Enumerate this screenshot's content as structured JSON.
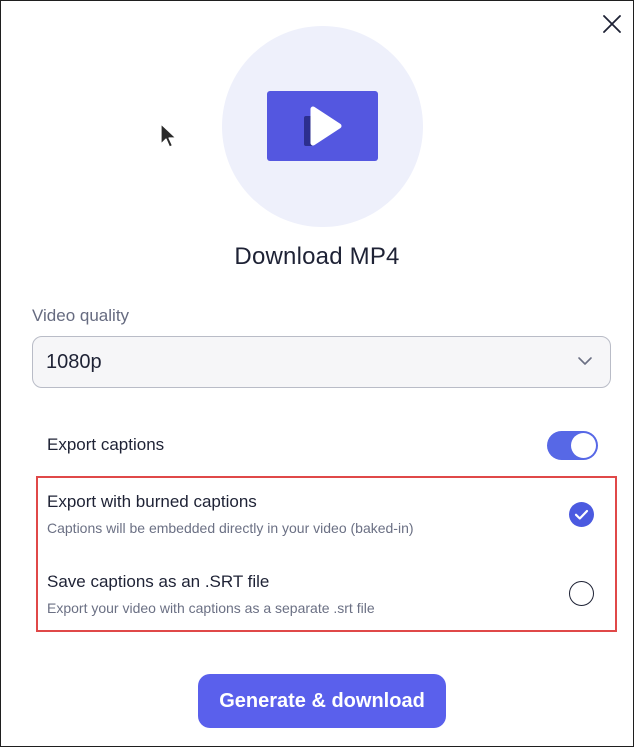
{
  "dialog": {
    "title": "Download MP4",
    "quality": {
      "label": "Video quality",
      "selected": "1080p"
    },
    "export_captions": {
      "label": "Export captions",
      "enabled": true
    },
    "options": [
      {
        "title": "Export with burned captions",
        "description": "Captions will be embedded directly in your video (baked-in)",
        "selected": true
      },
      {
        "title": "Save captions as an .SRT file",
        "description": "Export your video with captions as a separate .srt file",
        "selected": false
      }
    ],
    "primary_button": "Generate & download"
  },
  "icons": {
    "close": "close-icon",
    "hero": "video-play-icon",
    "chevron": "chevron-down-icon",
    "check": "check-icon"
  },
  "colors": {
    "accent": "#5a60ec",
    "toggle_on": "#5768e6",
    "radio_checked": "#4b5ae0",
    "highlight": "#e04848",
    "hero_bg": "#eef0fb"
  }
}
